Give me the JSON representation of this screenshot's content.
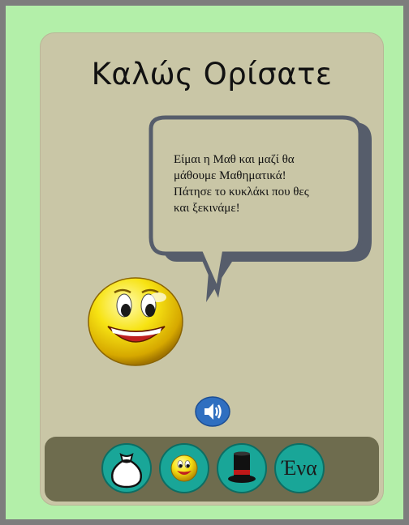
{
  "title": "Καλώς Ορίσατε",
  "speech": {
    "lines": [
      "Είμαι η Μαθ και μαζί θα",
      "μάθουμε Μαθηματικά!",
      "Πάτησε το κυκλάκι που θες",
      "και ξεκινάμε!"
    ]
  },
  "character": {
    "icon": "smiley-face-icon"
  },
  "sound_button": {
    "icon": "speaker-icon"
  },
  "nav": [
    {
      "icon": "money-bag-icon"
    },
    {
      "icon": "smiley-face-icon"
    },
    {
      "icon": "top-hat-icon"
    },
    {
      "label": "Ένα"
    }
  ],
  "colors": {
    "background": "#b3efa9",
    "card": "#c9c6a6",
    "bottom_bar": "#6e6c4e",
    "nav_button": "#19a698",
    "sound_button": "#2f6fc0"
  }
}
